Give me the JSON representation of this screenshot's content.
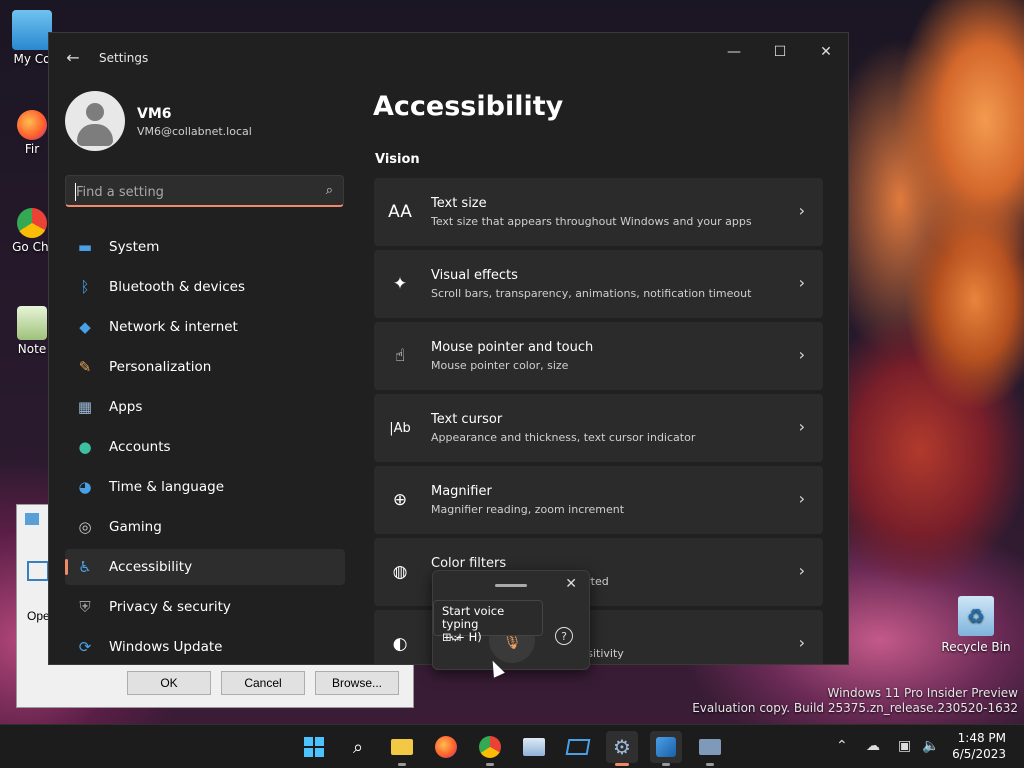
{
  "desktop": {
    "icons": [
      {
        "label": "My Co"
      },
      {
        "label": "Fir"
      },
      {
        "label": "Go Chi"
      },
      {
        "label": "Note"
      }
    ],
    "recycle_bin": "Recycle Bin",
    "watermark_line1": "Windows 11 Pro Insider Preview",
    "watermark_line2": "Evaluation copy. Build 25375.zn_release.230520-1632"
  },
  "bg_dialog": {
    "ope_text": "Ope",
    "ok": "OK",
    "cancel": "Cancel",
    "browse": "Browse..."
  },
  "window": {
    "title": "Settings",
    "controls": {
      "minimize": "—",
      "maximize": "☐",
      "close": "✕"
    }
  },
  "user": {
    "name": "VM6",
    "email": "VM6@collabnet.local"
  },
  "search": {
    "placeholder": "Find a setting"
  },
  "nav": [
    {
      "label": "System",
      "icon": "monitor-icon",
      "color": "#4aa0e6"
    },
    {
      "label": "Bluetooth & devices",
      "icon": "bluetooth-icon",
      "color": "#4aa0e6"
    },
    {
      "label": "Network & internet",
      "icon": "wifi-icon",
      "color": "#4aa0e6"
    },
    {
      "label": "Personalization",
      "icon": "brush-icon",
      "color": "#e6a25a"
    },
    {
      "label": "Apps",
      "icon": "apps-icon",
      "color": "#9ab8d8"
    },
    {
      "label": "Accounts",
      "icon": "person-icon",
      "color": "#3cc1a0"
    },
    {
      "label": "Time & language",
      "icon": "globe-clock-icon",
      "color": "#4aa0e6"
    },
    {
      "label": "Gaming",
      "icon": "gamepad-icon",
      "color": "#c8c8c8"
    },
    {
      "label": "Accessibility",
      "icon": "accessibility-icon",
      "color": "#4aa0e6"
    },
    {
      "label": "Privacy & security",
      "icon": "shield-icon",
      "color": "#9a9a9a"
    },
    {
      "label": "Windows Update",
      "icon": "update-icon",
      "color": "#4aa0e6"
    }
  ],
  "active_nav": "Accessibility",
  "main": {
    "title": "Accessibility",
    "section": "Vision",
    "cards": [
      {
        "title": "Text size",
        "subtitle": "Text size that appears throughout Windows and your apps",
        "icon": "text-size-icon"
      },
      {
        "title": "Visual effects",
        "subtitle": "Scroll bars, transparency, animations, notification timeout",
        "icon": "sparkle-icon"
      },
      {
        "title": "Mouse pointer and touch",
        "subtitle": "Mouse pointer color, size",
        "icon": "pointer-icon"
      },
      {
        "title": "Text cursor",
        "subtitle": "Appearance and thickness, text cursor indicator",
        "icon": "text-cursor-icon"
      },
      {
        "title": "Magnifier",
        "subtitle": "Magnifier reading, zoom increment",
        "icon": "magnifier-icon"
      },
      {
        "title": "Color filters",
        "subtitle": "le, inverted",
        "icon": "palette-icon"
      },
      {
        "title": "",
        "subtitle": "ght sensitivity",
        "icon": "contrast-icon"
      }
    ]
  },
  "voice_typing": {
    "tooltip_line1": "Start voice typing",
    "tooltip_line2": "⊞ + H)"
  },
  "taskbar": {
    "time": "1:48 PM",
    "date": "6/5/2023"
  }
}
